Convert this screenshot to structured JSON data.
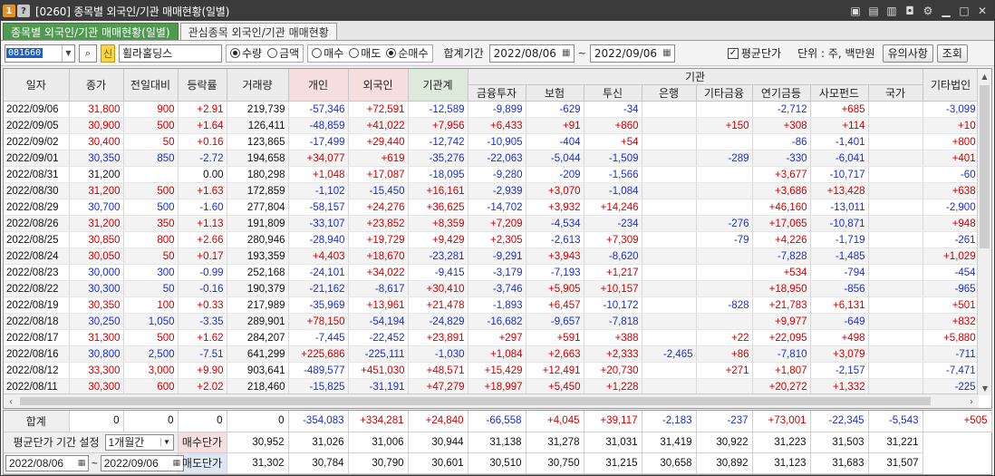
{
  "window": {
    "title": "[0260] 종목별 외국인/기관 매매현황(일별)",
    "badge_one": "1",
    "badge_q": "?"
  },
  "tabs": [
    {
      "label": "종목별 외국인/기관 매매현황(일별)"
    },
    {
      "label": "관심종목 외국인/기관 매매현황"
    }
  ],
  "toolbar": {
    "code": "081660",
    "shin": "신",
    "stock_name": "휠라홀딩스",
    "unit_radios": [
      "수량",
      "금액"
    ],
    "unit_selected": "수량",
    "trade_radios": [
      "매수",
      "매도",
      "순매수"
    ],
    "trade_selected": "순매수",
    "period_label": "합계기간",
    "date_from": "2022/08/06",
    "tilde": "~",
    "date_to": "2022/09/06",
    "avg_price_label": "평균단가",
    "avg_price_checked": true,
    "unit_text": "단위 : 주, 백만원",
    "notice_button": "유의사항",
    "query_button": "조회"
  },
  "grid": {
    "group_header": "기관",
    "columns": [
      "일자",
      "종가",
      "전일대비",
      "등락률",
      "거래량",
      "개인",
      "외국인",
      "기관계",
      "금융투자",
      "보험",
      "투신",
      "은행",
      "기타금융",
      "연기금등",
      "사모펀드",
      "국가",
      "기타법인"
    ],
    "rows": [
      [
        "2022/09/06",
        "31,800",
        "900",
        "+2.91",
        "219,739",
        "-57,346",
        "+72,591",
        "-12,589",
        "-9,899",
        "-629",
        "-34",
        "",
        "",
        "-2,712",
        "+685",
        "",
        "-3,099"
      ],
      [
        "2022/09/05",
        "30,900",
        "500",
        "+1.64",
        "126,411",
        "-48,859",
        "+41,022",
        "+7,956",
        "+6,433",
        "+91",
        "+860",
        "",
        "+150",
        "+308",
        "+114",
        "",
        "+10"
      ],
      [
        "2022/09/02",
        "30,400",
        "50",
        "+0.16",
        "123,865",
        "-17,499",
        "+29,440",
        "-12,742",
        "-10,905",
        "-404",
        "+54",
        "",
        "",
        "-86",
        "-1,401",
        "",
        "+800"
      ],
      [
        "2022/09/01",
        "30,350",
        "850",
        "-2.72",
        "194,658",
        "+34,077",
        "+619",
        "-35,276",
        "-22,063",
        "-5,044",
        "-1,509",
        "",
        "-289",
        "-330",
        "-6,041",
        "",
        "+401"
      ],
      [
        "2022/08/31",
        "31,200",
        "",
        "0.00",
        "180,298",
        "+1,048",
        "+17,087",
        "-18,095",
        "-9,280",
        "-209",
        "-1,566",
        "",
        "",
        "+3,677",
        "-10,717",
        "",
        "-60"
      ],
      [
        "2022/08/30",
        "31,200",
        "500",
        "+1.63",
        "172,859",
        "-1,102",
        "-15,450",
        "+16,161",
        "-2,939",
        "+3,070",
        "-1,084",
        "",
        "",
        "+3,686",
        "+13,428",
        "",
        "+638"
      ],
      [
        "2022/08/29",
        "30,700",
        "500",
        "-1.60",
        "277,804",
        "-58,157",
        "+24,276",
        "+36,625",
        "-14,702",
        "+3,932",
        "+14,246",
        "",
        "",
        "+46,160",
        "-13,011",
        "",
        "-2,900"
      ],
      [
        "2022/08/26",
        "31,200",
        "350",
        "+1.13",
        "191,809",
        "-33,107",
        "+23,852",
        "+8,359",
        "+7,209",
        "-4,534",
        "-234",
        "",
        "-276",
        "+17,065",
        "-10,871",
        "",
        "+948"
      ],
      [
        "2022/08/25",
        "30,850",
        "800",
        "+2.66",
        "280,946",
        "-28,940",
        "+19,729",
        "+9,429",
        "+2,305",
        "-2,613",
        "+7,309",
        "",
        "-79",
        "+4,226",
        "-1,719",
        "",
        "-261"
      ],
      [
        "2022/08/24",
        "30,050",
        "50",
        "+0.17",
        "193,359",
        "+4,403",
        "+18,670",
        "-23,281",
        "-9,291",
        "+3,943",
        "-8,620",
        "",
        "",
        "-7,828",
        "-1,485",
        "",
        "+1,029"
      ],
      [
        "2022/08/23",
        "30,000",
        "300",
        "-0.99",
        "252,168",
        "-24,101",
        "+34,022",
        "-9,415",
        "-3,179",
        "-7,193",
        "+1,217",
        "",
        "",
        "+534",
        "-794",
        "",
        "-454"
      ],
      [
        "2022/08/22",
        "30,300",
        "50",
        "-0.16",
        "190,379",
        "-21,162",
        "-8,617",
        "+30,410",
        "-3,746",
        "+5,905",
        "+10,157",
        "",
        "",
        "+18,950",
        "-856",
        "",
        "-965"
      ],
      [
        "2022/08/19",
        "30,350",
        "100",
        "+0.33",
        "217,989",
        "-35,969",
        "+13,961",
        "+21,478",
        "-1,893",
        "+6,457",
        "-10,172",
        "",
        "-828",
        "+21,783",
        "+6,131",
        "",
        "+501"
      ],
      [
        "2022/08/18",
        "30,250",
        "1,050",
        "-3.35",
        "289,901",
        "+78,150",
        "-54,194",
        "-24,829",
        "-16,682",
        "-9,657",
        "-7,818",
        "",
        "",
        "+9,977",
        "-649",
        "",
        "+832"
      ],
      [
        "2022/08/17",
        "31,300",
        "500",
        "+1.62",
        "284,207",
        "-7,445",
        "-22,452",
        "+23,891",
        "+297",
        "+591",
        "+388",
        "",
        "+22",
        "+22,095",
        "+498",
        "",
        "+5,880"
      ],
      [
        "2022/08/16",
        "30,800",
        "2,500",
        "-7.51",
        "641,299",
        "+225,686",
        "-225,111",
        "-1,030",
        "+1,084",
        "+2,663",
        "+2,333",
        "-2,465",
        "+86",
        "-7,810",
        "+3,079",
        "",
        "-711"
      ],
      [
        "2022/08/12",
        "33,300",
        "3,000",
        "+9.90",
        "903,641",
        "-489,577",
        "+451,030",
        "+48,571",
        "+15,429",
        "+12,491",
        "+20,730",
        "",
        "+271",
        "+1,807",
        "-2,157",
        "",
        "-7,471"
      ],
      [
        "2022/08/11",
        "30,300",
        "600",
        "+2.02",
        "218,460",
        "-15,825",
        "-31,191",
        "+47,279",
        "+18,997",
        "+5,450",
        "+1,228",
        "",
        "",
        "+20,272",
        "+1,332",
        "",
        "-225"
      ]
    ]
  },
  "summary": {
    "total_label": "합계",
    "totals": [
      "0",
      "0",
      "0",
      "0",
      "-354,083",
      "+334,281",
      "+24,840",
      "-66,558",
      "+4,045",
      "+39,117",
      "-2,183",
      "-237",
      "+73,001",
      "-22,345",
      "-5,543",
      "+505"
    ],
    "avg_period_label": "평균단가 기간 설정",
    "avg_period_value": "1개월간",
    "buy_avg_label": "매수단가",
    "buy_avg": [
      "30,952",
      "31,026",
      "31,006",
      "30,944",
      "31,138",
      "31,278",
      "31,031",
      "31,419",
      "30,922",
      "31,223",
      "31,503",
      "31,221"
    ],
    "avg_date_from": "2022/08/06",
    "avg_tilde": "~",
    "avg_date_to": "2022/09/06",
    "sell_avg_label": "매도단가",
    "sell_avg": [
      "31,302",
      "30,784",
      "30,790",
      "30,601",
      "30,510",
      "30,750",
      "31,215",
      "30,658",
      "30,892",
      "31,123",
      "31,683",
      "31,507"
    ]
  },
  "colors": {
    "up": "#d00000",
    "down": "#1a2fd0",
    "active_tab": "#4f9a4f",
    "pink_header": "#f6dede",
    "blue_header": "#dde6f3",
    "green_header": "#dde9db"
  },
  "icons": [
    "window-menu-icon",
    "save-icon",
    "link-icon",
    "screenshot-icon",
    "settings-icon",
    "minimize-icon",
    "maximize-icon",
    "close-icon",
    "search-icon",
    "calendar-icon",
    "dropdown-icon"
  ]
}
